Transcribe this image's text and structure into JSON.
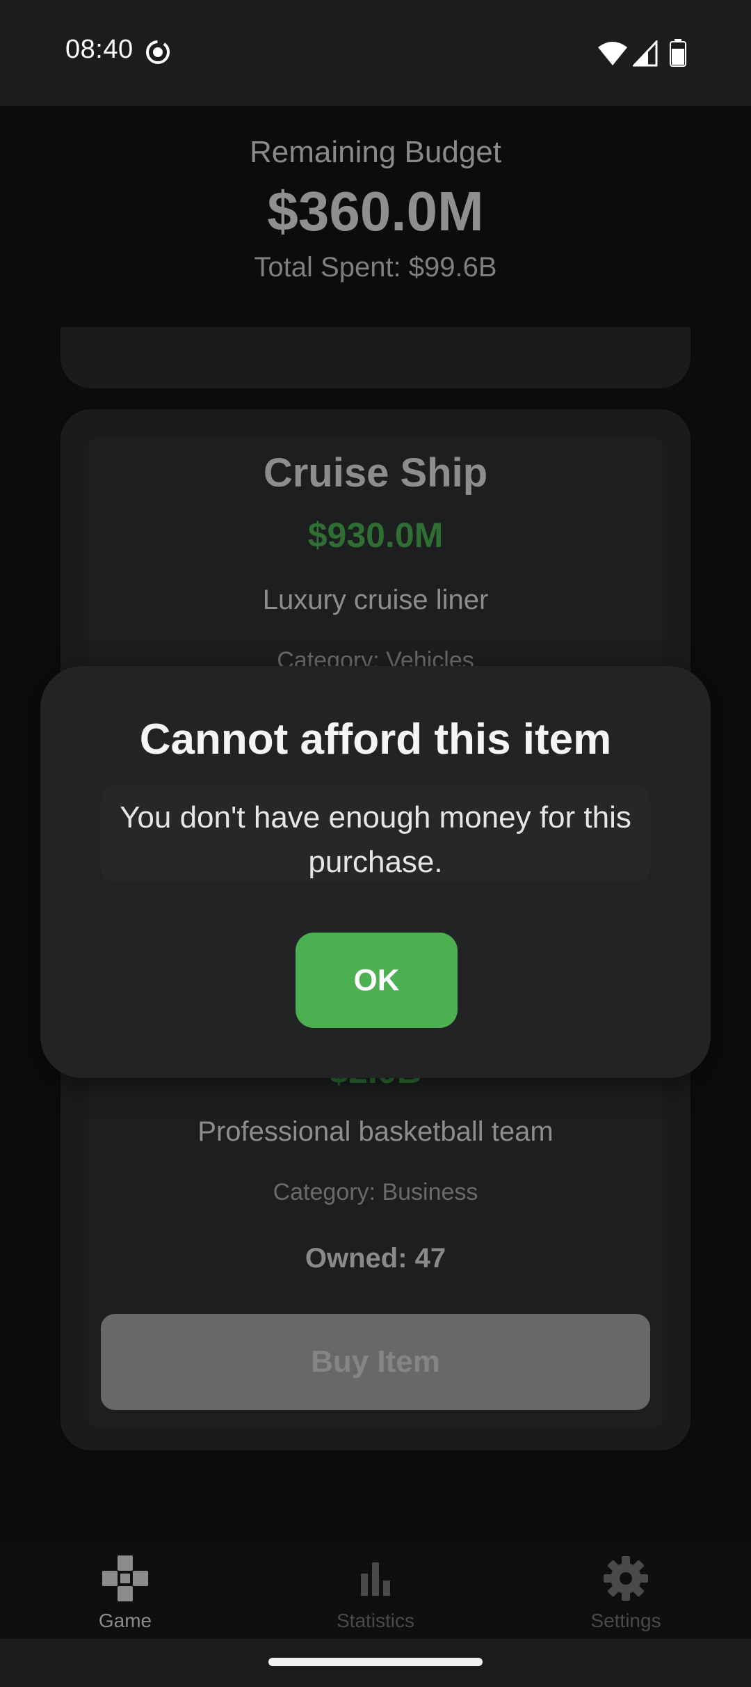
{
  "status_bar": {
    "time": "08:40"
  },
  "header": {
    "budget_label": "Remaining Budget",
    "budget_value": "$360.0M",
    "total_spent": "Total Spent: $99.6B"
  },
  "items": [
    {
      "name": "Cruise Ship",
      "price": "$930.0M",
      "description": "Luxury cruise liner",
      "category": "Category: Vehicles"
    },
    {
      "price": "$2.0B",
      "description": "Professional basketball team",
      "category": "Category: Business",
      "owned": "Owned: 47",
      "buy_label": "Buy Item"
    }
  ],
  "dialog": {
    "title": "Cannot afford this item",
    "message": "You don't have enough money for this purchase.",
    "ok_label": "OK"
  },
  "nav": {
    "game": "Game",
    "statistics": "Statistics",
    "settings": "Settings"
  },
  "colors": {
    "accent_green": "#4caf50",
    "active_nav": "#8c8c8c",
    "inactive_nav": "#4a4a4a"
  }
}
